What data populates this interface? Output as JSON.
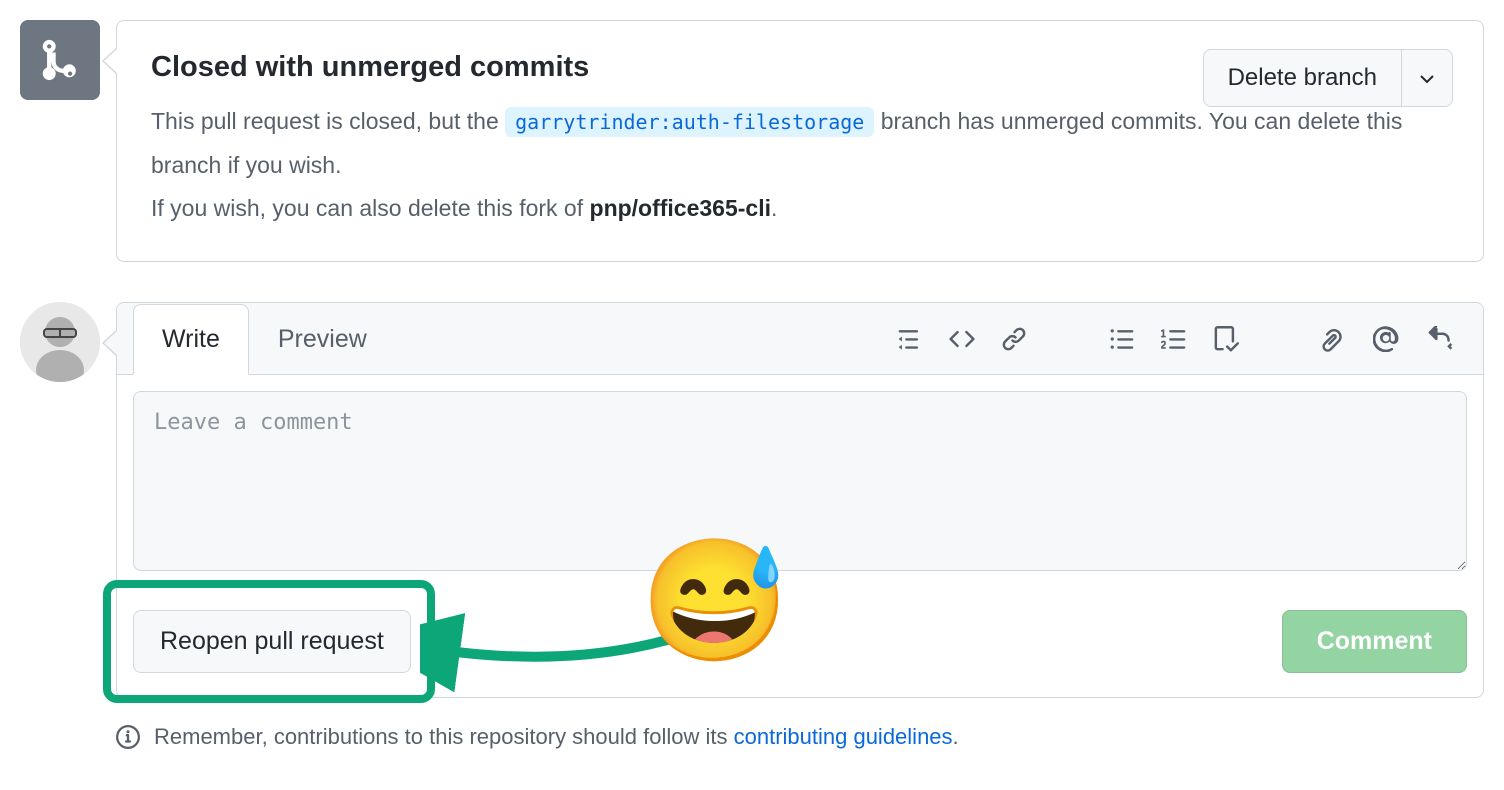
{
  "merge": {
    "title": "Closed with unmerged commits",
    "text_before_branch": "This pull request is closed, but the ",
    "branch": "garrytrinder:auth-filestorage",
    "text_after_branch": " branch has unmerged commits. You can delete this branch if you wish.",
    "text_line2_before": "If you wish, you can also delete this fork of ",
    "fork_repo": "pnp/office365-cli",
    "text_line2_after": ".",
    "delete_branch_label": "Delete branch"
  },
  "comment_form": {
    "tabs": {
      "write": "Write",
      "preview": "Preview"
    },
    "placeholder": "Leave a comment",
    "reopen_label": "Reopen pull request",
    "comment_label": "Comment"
  },
  "footer": {
    "text_before": "Remember, contributions to this repository should follow its ",
    "link_text": "contributing guidelines",
    "text_after": "."
  },
  "overlay": {
    "emoji": "😅"
  }
}
